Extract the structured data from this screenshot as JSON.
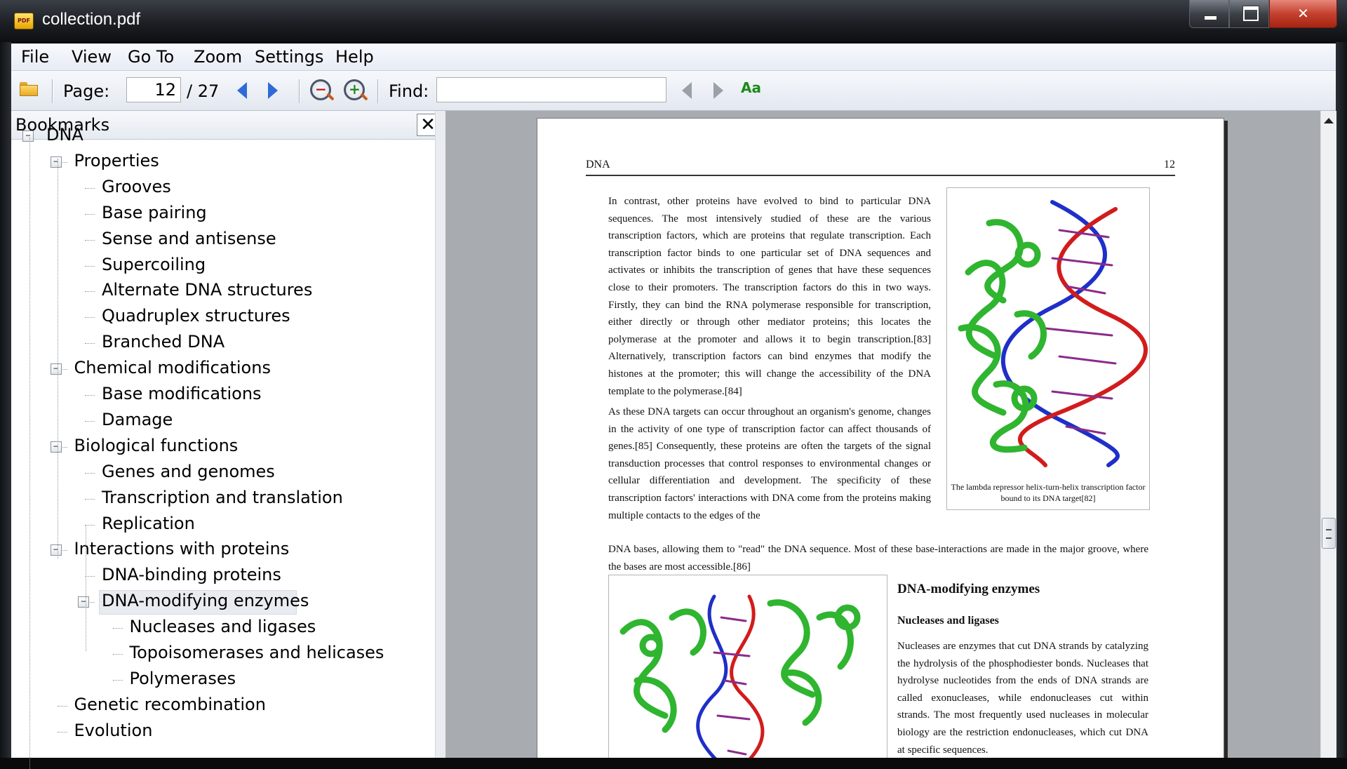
{
  "window": {
    "title": "collection.pdf",
    "app_icon_text": "PDF",
    "min_glyph": "",
    "max_glyph": "",
    "close_glyph": "✕"
  },
  "menu": [
    "File",
    "View",
    "Go To",
    "Zoom",
    "Settings",
    "Help"
  ],
  "toolbar": {
    "page_label": "Page:",
    "page_value": "12",
    "page_total": "/ 27",
    "find_label": "Find:",
    "find_value": "",
    "icons": {
      "open": "folder-icon",
      "prev_page": "arrow-left-icon",
      "next_page": "arrow-right-icon",
      "zoom_out": "zoom-out-icon",
      "zoom_in": "zoom-in-icon",
      "find_prev": "arrow-left-icon",
      "find_next": "arrow-right-icon",
      "match_case": "match-case-icon"
    },
    "match_case_glyph": "Aa"
  },
  "sidebar": {
    "title": "Bookmarks",
    "close_glyph": "✕",
    "tree": [
      {
        "label": "DNA",
        "depth": 0,
        "expandable": true
      },
      {
        "label": "Properties",
        "depth": 1,
        "expandable": true
      },
      {
        "label": "Grooves",
        "depth": 2
      },
      {
        "label": "Base pairing",
        "depth": 2
      },
      {
        "label": "Sense and antisense",
        "depth": 2
      },
      {
        "label": "Supercoiling",
        "depth": 2
      },
      {
        "label": "Alternate DNA structures",
        "depth": 2
      },
      {
        "label": "Quadruplex structures",
        "depth": 2
      },
      {
        "label": "Branched DNA",
        "depth": 2
      },
      {
        "label": "Chemical modifications",
        "depth": 1,
        "expandable": true
      },
      {
        "label": "Base modifications",
        "depth": 2
      },
      {
        "label": "Damage",
        "depth": 2
      },
      {
        "label": "Biological functions",
        "depth": 1,
        "expandable": true
      },
      {
        "label": "Genes and genomes",
        "depth": 2
      },
      {
        "label": "Transcription and translation",
        "depth": 2
      },
      {
        "label": "Replication",
        "depth": 2
      },
      {
        "label": "Interactions with proteins",
        "depth": 1,
        "expandable": true
      },
      {
        "label": "DNA-binding proteins",
        "depth": 2
      },
      {
        "label": "DNA-modifying enzymes",
        "depth": 2,
        "expandable": true,
        "selected": true
      },
      {
        "label": "Nucleases and ligases",
        "depth": 3
      },
      {
        "label": "Topoisomerases and helicases",
        "depth": 3
      },
      {
        "label": "Polymerases",
        "depth": 3
      },
      {
        "label": "Genetic recombination",
        "depth": 1
      },
      {
        "label": "Evolution",
        "depth": 1
      }
    ]
  },
  "document": {
    "running_head": "DNA",
    "page_number": "12",
    "para1": "In contrast, other proteins have evolved to bind to particular DNA sequences. The most intensively studied of these are the various transcription factors, which are proteins that regulate transcription. Each transcription factor binds to one particular set of DNA sequences and activates or inhibits the transcription of genes that have these sequences close to their promoters. The transcription factors do this in two ways. Firstly, they can bind the RNA polymerase responsible for transcription, either directly or through other mediator proteins; this locates the polymerase at the promoter and allows it to begin transcription.[83] Alternatively, transcription factors can bind enzymes that modify the histones at the promoter; this will change the accessibility of the DNA template to the polymerase.[84]",
    "para2a": "As these DNA targets can occur throughout an organism's genome, changes in the activity of one type of transcription factor can affect thousands of genes.[85] Consequently, these proteins are often the targets of the signal transduction processes that control responses to environmental changes or cellular differentiation and development. The specificity of these transcription factors' interactions with DNA come from the proteins making multiple contacts to the edges of the",
    "para2b": "DNA bases, allowing them to \"read\" the DNA sequence. Most of these base-interactions are made in the major groove, where the bases are most accessible.[86]",
    "figure1_caption": "The lambda repressor helix-turn-helix transcription factor bound to its DNA target[82]",
    "heading_enzymes": "DNA-modifying enzymes",
    "heading_nucleases": "Nucleases and ligases",
    "para3": "Nucleases are enzymes that cut DNA strands by catalyzing the hydrolysis of the phosphodiester bonds. Nucleases that hydrolyse nucleotides from the ends of DNA strands are called exonucleases, while endonucleases cut within strands. The most frequently used nucleases in molecular biology are the restriction endonucleases, which cut DNA at specific sequences."
  },
  "colors": {
    "protein": "#2fb52f",
    "dna_strand_a": "#1f2fc8",
    "dna_strand_b": "#d21c1c",
    "page_bg": "#ffffff",
    "viewer_bg": "#a8acb1"
  }
}
